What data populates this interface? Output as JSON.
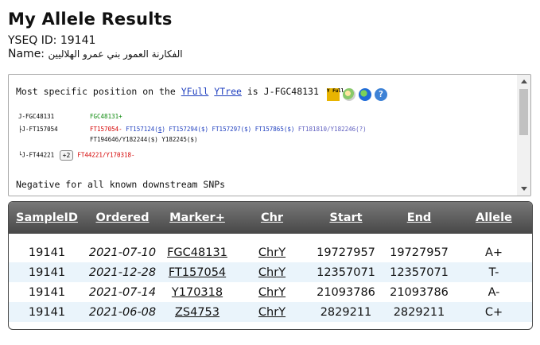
{
  "page": {
    "title": "My Allele Results",
    "yseq_label": "YSEQ ID:",
    "yseq_id": "19141",
    "name_label": "Name:",
    "name_value": "الفكارنة العمور بني عمرو الهلاليين"
  },
  "panel": {
    "prefix": "Most specific position on the",
    "link_yfull": "YFull",
    "link_ytree": "YTree",
    "is_text": "is",
    "position": "J-FGC48131",
    "icons": [
      "yfull-icon",
      "globe-map-icon",
      "world-globe-icon",
      "help-icon"
    ],
    "yfull_icon_text": "Y Full",
    "help_icon_text": "?",
    "tree": {
      "row1": {
        "hap": "J-FGC48131",
        "snp": "FGC48131+"
      },
      "row2": {
        "hap": "├J-FT157054",
        "red": "FT157054-",
        "blue_line1": "FT157124(",
        "blue_line1_link": "$",
        "blue_line1_end": ")",
        "items_line1": [
          "FT157294($)",
          "FT157297($)",
          "FT157865($)"
        ],
        "purple_line1": "FT181810/Y182246(?)",
        "items_line2": [
          "FT194646/Y182244($)",
          "Y182245($)"
        ]
      },
      "row3": {
        "hap": "└J-FT44221",
        "button": "+2",
        "snp": "FT44221/Y170318-"
      }
    },
    "negative": "Negative for all known downstream SNPs"
  },
  "table": {
    "headers": [
      "SampleID",
      "Ordered",
      "Marker+",
      "Chr",
      "Start",
      "End",
      "Allele"
    ],
    "rows": [
      [
        "19141",
        "2021-07-10",
        "FGC48131",
        "ChrY",
        "19727957",
        "19727957",
        "A+"
      ],
      [
        "19141",
        "2021-12-28",
        "FT157054",
        "ChrY",
        "12357071",
        "12357071",
        "T-"
      ],
      [
        "19141",
        "2021-07-14",
        "Y170318",
        "ChrY",
        "21093786",
        "21093786",
        "A-"
      ],
      [
        "19141",
        "2021-06-08",
        "ZS4753",
        "ChrY",
        "2829211",
        "2829211",
        "C+"
      ]
    ]
  },
  "colors": {
    "link": "#1f3fbf",
    "positive": "#0c8a0c",
    "negative": "#d40000",
    "uncertain": "#6060c0",
    "row_alt": "#eaf4fb",
    "header_bg": "#5a5a5a"
  }
}
